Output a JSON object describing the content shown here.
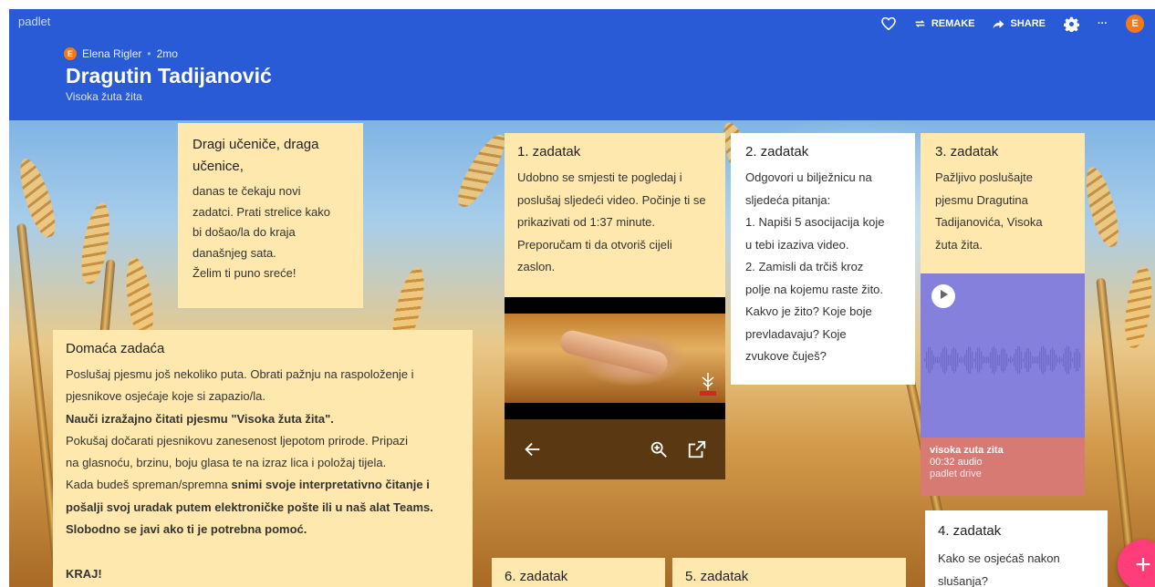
{
  "header": {
    "brand": "padlet",
    "author_initial": "E",
    "author": "Elena Rigler",
    "age": "2mo",
    "title": "Dragutin Tadijanović",
    "subtitle": "Visoka žuta žita",
    "toolbar": {
      "heart_icon": "heart-icon",
      "remake_label": "REMAKE",
      "share_label": "SHARE",
      "settings_icon": "gear-icon",
      "more_label": "···",
      "user_initial": "E"
    },
    "colors": {
      "header_bg": "#2a5bd7",
      "avatar": "#f07a1a"
    }
  },
  "posts": {
    "intro": {
      "title": "Dragi učeniče, draga učenice,",
      "body": [
        "danas te čekaju novi",
        "zadatci. Prati strelice kako",
        "bi došao/la do kraja",
        "današnjeg sata.",
        "Želim ti puno sreće!"
      ]
    },
    "homework": {
      "title": "Domaća zadaća",
      "line1": "Poslušaj pjesmu još nekoliko puta. Obrati pažnju na raspoloženje i",
      "line2": "pjesnikove osjećaje koje si zapazio/la.",
      "line3_bold": "Nauči izražajno čitati pjesmu \"Visoka žuta žita\".",
      "line4": "Pokušaj dočarati pjesnikovu zanesenost ljepotom prirode. Pripazi",
      "line5": "na glasnoću, brzinu, boju glasa te na izraz lica i položaj tijela.",
      "line6_plain": "Kada budeš spreman/spremna ",
      "line6_bold": "snimi svoje interpretativno čitanje i",
      "line7_bold": "pošalji svoj uradak putem elektroničke pošte ili u naš alat Teams.",
      "line8_bold": "Slobodno se javi ako ti je potrebna pomoć.",
      "end_label": "KRAJ!"
    },
    "task1": {
      "title": "1. zadatak",
      "body": "Udobno se smjesti te pogledaj i poslušaj sljedeći video. Počinje ti se prikazivati od 1:37 minute. Preporučam ti da otvoriš cijeli zaslon.",
      "video_controls": [
        "arrow-left-icon",
        "zoom-in-icon",
        "open-external-icon"
      ]
    },
    "task2": {
      "title": "2. zadatak",
      "body": [
        "Odgovori u bilježnicu na",
        "sljedeća pitanja:",
        "1. Napiši 5 asocijacija koje",
        "u tebi izaziva video.",
        "2. Zamisli da trčiš kroz",
        "polje na kojemu raste žito.",
        "Kakvo je žito? Koje boje",
        "prevladavaju? Koje",
        "zvukove čuješ?"
      ]
    },
    "task3": {
      "title": "3. zadatak",
      "body": [
        "Pažljivo poslušajte",
        "pjesmu Dragutina",
        "Tadijanovića, Visoka",
        "žuta žita."
      ],
      "audio_title": "visoka zuta zita",
      "audio_info": "00:32 audio",
      "audio_source": "padlet drive",
      "audio_bg": "#8480dc",
      "audio_meta_bg": "#d77a74"
    },
    "task4": {
      "title": "4. zadatak",
      "body": "Kako se osjećaš nakon slušanja?"
    },
    "task5": {
      "title": "5. zadatak"
    },
    "task6": {
      "title": "6. zadatak"
    }
  },
  "fab": {
    "label": "+",
    "color": "#ff3d7a"
  }
}
